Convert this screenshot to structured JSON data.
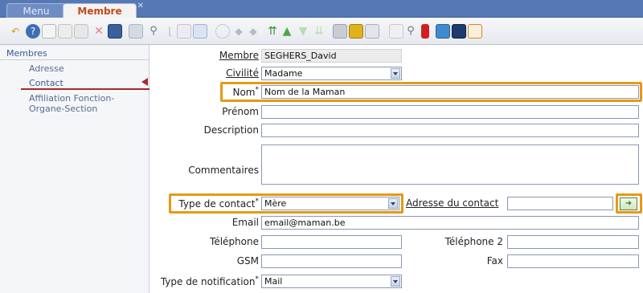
{
  "tabs": [
    {
      "label": "Menu"
    },
    {
      "label": "Membre"
    }
  ],
  "toolbar": {
    "icons": [
      "undo-icon",
      "help-icon",
      "new-icon",
      "copy-icon",
      "paste-icon",
      "delete-icon",
      "save-icon",
      "refresh-icon",
      "search-icon",
      "attach-icon",
      "note-icon",
      "window-icon",
      "target-icon",
      "prev-icon",
      "next-icon",
      "first-icon",
      "up-icon",
      "down-icon",
      "last-icon",
      "print-icon",
      "report-icon",
      "printer-icon",
      "folder-icon",
      "find-icon",
      "export-icon",
      "tools-icon",
      "book-icon",
      "chart-icon"
    ]
  },
  "sidebar": {
    "header": "Membres",
    "items": [
      "Adresse",
      "Contact",
      "Affiliation Fonction-",
      "Organe-Section"
    ],
    "active": "Contact"
  },
  "form": {
    "membre": {
      "label": "Membre",
      "value": "SEGHERS_David"
    },
    "civilite": {
      "label": "Civilité",
      "value": "Madame"
    },
    "nom": {
      "label": "Nom",
      "required": "*",
      "value": "Nom de la Maman"
    },
    "prenom": {
      "label": "Prénom",
      "value": ""
    },
    "description": {
      "label": "Description",
      "value": ""
    },
    "commentaires": {
      "label": "Commentaires",
      "value": ""
    },
    "type_contact": {
      "label": "Type de contact",
      "required": "*",
      "value": "Mère"
    },
    "adresse_contact": {
      "label": "Adresse du contact",
      "value": ""
    },
    "email": {
      "label": "Email",
      "value": "email@maman.be"
    },
    "telephone": {
      "label": "Téléphone",
      "value": ""
    },
    "telephone2": {
      "label": "Téléphone 2",
      "value": ""
    },
    "gsm": {
      "label": "GSM",
      "value": ""
    },
    "fax": {
      "label": "Fax",
      "value": ""
    },
    "type_notification": {
      "label": "Type de notification",
      "required": "*",
      "value": "Mail"
    }
  },
  "colors": {
    "tab_bar": "#5679b6",
    "highlight": "#e59a16",
    "active_marker": "#a72a2a"
  }
}
